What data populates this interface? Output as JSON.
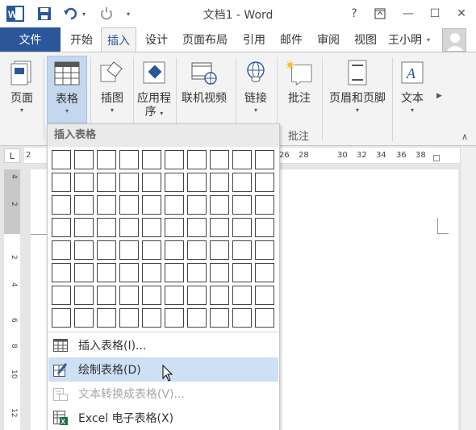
{
  "window": {
    "title": "文档1 - Word",
    "help": "?",
    "ribbon_display": "⊡",
    "minimize": "—",
    "maximize": "☐",
    "close": "✕"
  },
  "quick_access": {
    "undo_arrow": "▾",
    "more": "▾"
  },
  "tabs": [
    {
      "label": "文件"
    },
    {
      "label": "开始"
    },
    {
      "label": "插入"
    },
    {
      "label": "设计"
    },
    {
      "label": "页面布局"
    },
    {
      "label": "引用"
    },
    {
      "label": "邮件"
    },
    {
      "label": "审阅"
    },
    {
      "label": "视图"
    }
  ],
  "user": {
    "name": "王小明",
    "arrow": "▾"
  },
  "ribbon": {
    "pages": "页面",
    "table": "表格",
    "illustrations": "插图",
    "apps_line1": "应用程",
    "apps_line2": "序",
    "online_video": "联机视频",
    "links": "链接",
    "comment": "批注",
    "header_footer": "页眉和页脚",
    "text": "文本",
    "group_comment": "批注",
    "arrow": "▾",
    "scroll_right": "▶",
    "collapse": "∧"
  },
  "ruler": {
    "corner": "L",
    "ticks": [
      "2",
      "26",
      "28",
      "30",
      "32",
      "34",
      "36",
      "38"
    ],
    "vticks": [
      "4",
      "2",
      "2",
      "4",
      "6",
      "8",
      "10",
      "12"
    ]
  },
  "dropdown": {
    "header": "插入表格",
    "grid": {
      "columns": 10,
      "rows": 8
    },
    "items": [
      {
        "label": "插入表格(I)...",
        "state": "enabled"
      },
      {
        "label": "绘制表格(D)",
        "state": "highlighted"
      },
      {
        "label": "文本转换成表格(V)...",
        "state": "disabled"
      },
      {
        "label": "Excel 电子表格(X)",
        "state": "enabled"
      }
    ]
  },
  "colors": {
    "accent": "#2b579a",
    "selection": "#c5d7ee",
    "menu_highlight": "#cde0f5",
    "ribbon_bg": "#f3f3f3"
  }
}
